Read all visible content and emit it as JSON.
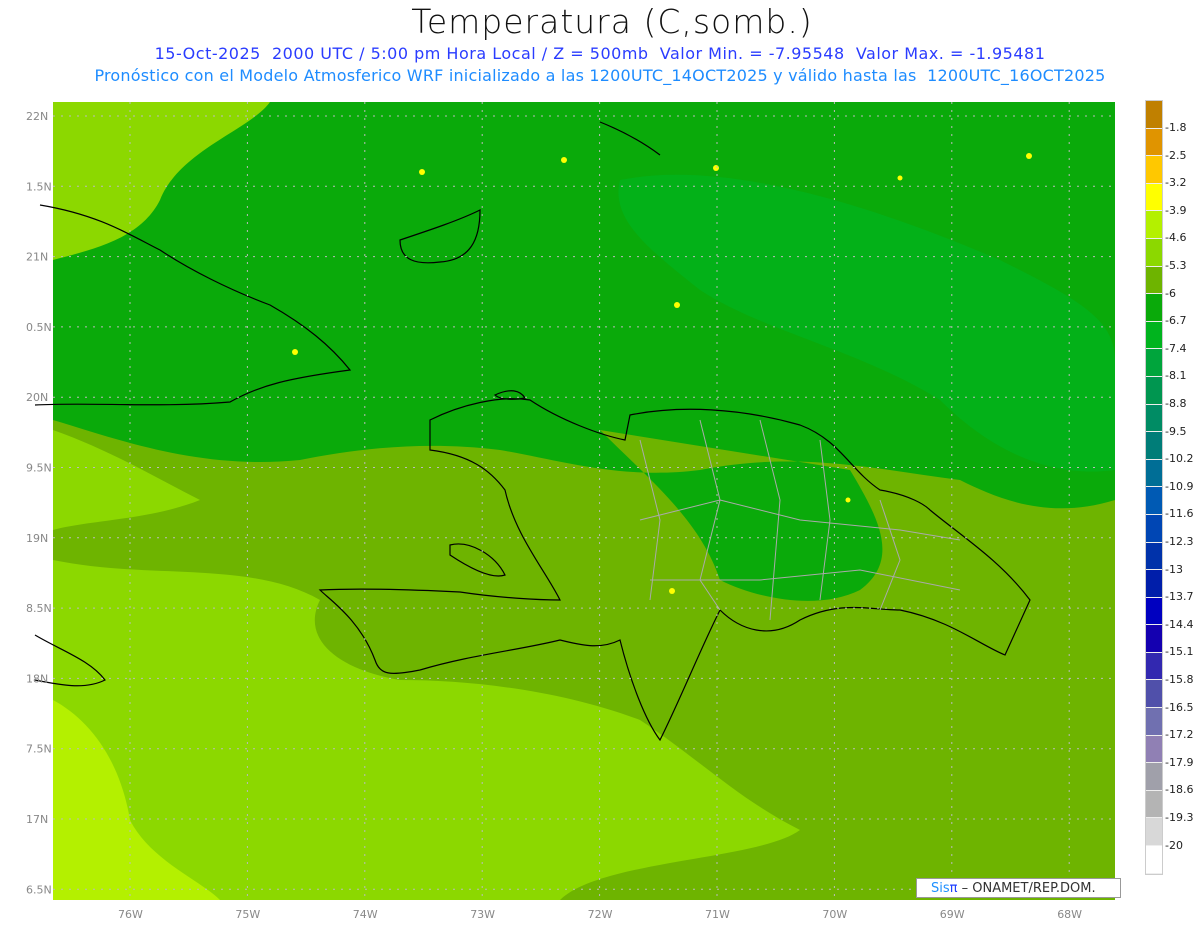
{
  "title": "Temperatura (C,somb.)",
  "subtitle_line1": "15-Oct-2025  2000 UTC / 5:00 pm Hora Local / Z = 500mb  Valor Min. = -7.95548  Valor Max. = -1.95481",
  "subtitle_line2": "Pronóstico con el Modelo Atmosferico WRF inicializado a las 1200UTC_14OCT2025 y válido hasta las  1200UTC_16OCT2025",
  "lat_labels": [
    "22N",
    "1.5N",
    "21N",
    "0.5N",
    "20N",
    "9.5N",
    "19N",
    "8.5N",
    "18N",
    "7.5N",
    "17N",
    "6.5N"
  ],
  "lon_labels": [
    "76W",
    "75W",
    "74W",
    "73W",
    "72W",
    "71W",
    "70W",
    "69W",
    "68W"
  ],
  "colorbar": {
    "labels": [
      "-1.8",
      "-2.5",
      "-3.2",
      "-3.9",
      "-4.6",
      "-5.3",
      "-6",
      "-6.7",
      "-7.4",
      "-8.1",
      "-8.8",
      "-9.5",
      "-10.2",
      "-10.9",
      "-11.6",
      "-12.3",
      "-13",
      "-13.7",
      "-14.4",
      "-15.1",
      "-15.8",
      "-16.5",
      "-17.2",
      "-17.9",
      "-18.6",
      "-19.3",
      "-20"
    ],
    "colors": [
      "#c08000",
      "#e09400",
      "#ffc800",
      "#ffff00",
      "#b4f000",
      "#8cd800",
      "#6eb400",
      "#0aaa0a",
      "#00b41e",
      "#00a53c",
      "#009650",
      "#008c64",
      "#007d78",
      "#006e96",
      "#005ab4",
      "#0046b4",
      "#0032aa",
      "#001eaa",
      "#0000c0",
      "#1400b0",
      "#3228b0",
      "#5050aa",
      "#7070b0",
      "#9080b4",
      "#a0a0aa",
      "#b4b4b4",
      "#d8d8d8",
      "#ffffff"
    ]
  },
  "logo": {
    "sis": "Sis",
    "pi": "π",
    "rest": " – ONAMET/REP.DOM."
  }
}
